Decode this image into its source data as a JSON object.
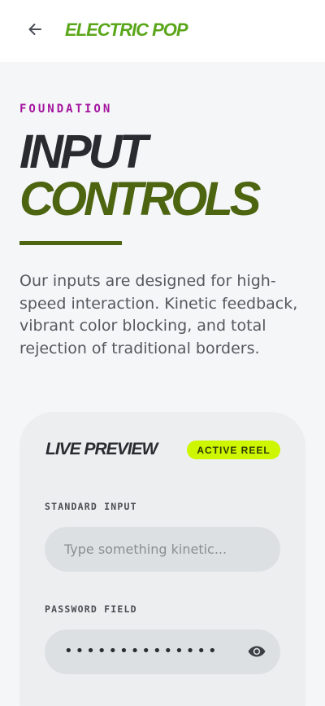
{
  "app_bar": {
    "brand": "ELECTRIC POP",
    "back_icon": "arrow-left-icon"
  },
  "hero": {
    "eyebrow": "FOUNDATION",
    "title_line_1": "INPUT",
    "title_line_2": "CONTROLS",
    "lead": "Our inputs are designed for high-speed interaction. Kinetic feedback, vibrant color blocking, and total rejection of traditional borders."
  },
  "preview_card": {
    "title": "LIVE PREVIEW",
    "badge": "ACTIVE REEL",
    "standard_input": {
      "label": "STANDARD INPUT",
      "placeholder": "Type something kinetic...",
      "value": ""
    },
    "password_input": {
      "label": "PASSWORD FIELD",
      "masked_value": "••••••••••••••",
      "toggle_icon": "eye-icon"
    }
  },
  "colors": {
    "brand_green": "#5aa61a",
    "eyebrow_magenta": "#a4139f",
    "olive": "#4d6410",
    "badge_lime": "#cdf600",
    "page_bg": "#f5f6f8",
    "card_bg": "#eceef0",
    "field_bg": "#dde0e2"
  }
}
